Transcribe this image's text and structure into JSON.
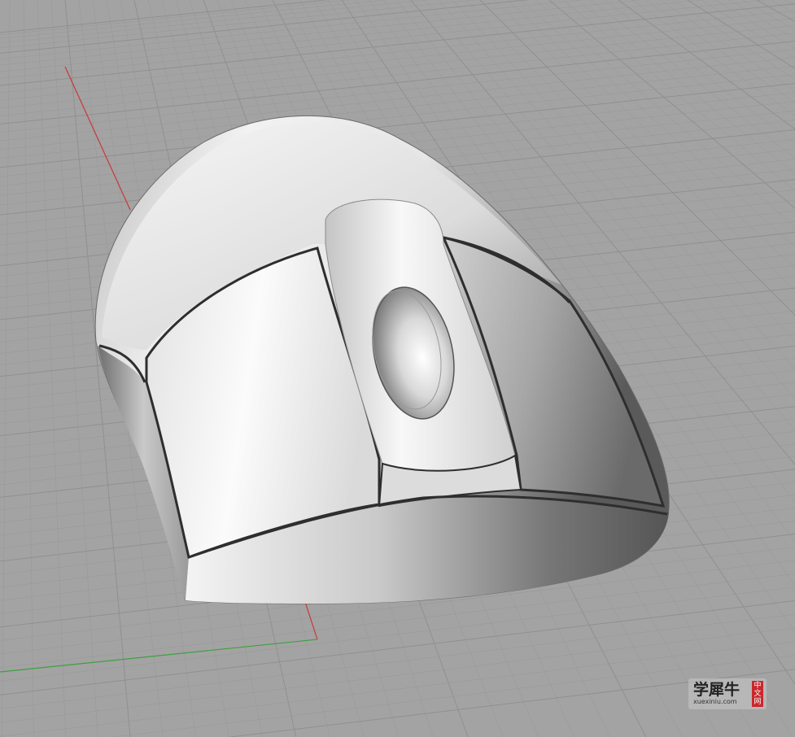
{
  "viewport": {
    "background_color": "#a3a3a3",
    "grid_color": "#8e8e8e",
    "x_axis_color": "#c8373a",
    "y_axis_color": "#3f9f3f",
    "object": "mouse-model"
  },
  "watermark": {
    "main_text": "学犀牛",
    "url_text": "xuexiniu.com",
    "tag_text": [
      "中",
      "文",
      "网"
    ]
  }
}
